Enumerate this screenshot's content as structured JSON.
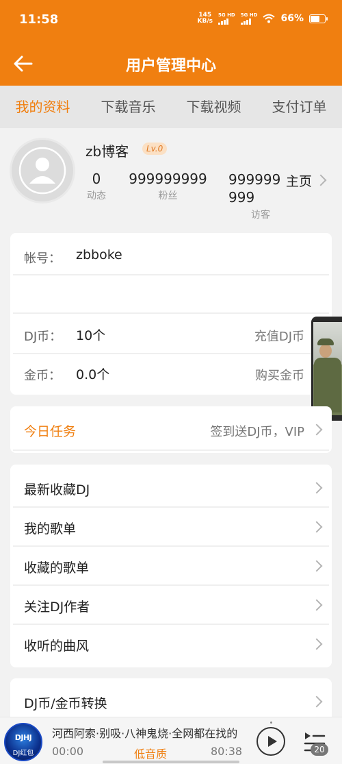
{
  "status_bar": {
    "time": "11:58",
    "net_speed_value": "145",
    "net_speed_unit": "KB/s",
    "sim1": "5G HD",
    "sim2": "5G HD",
    "battery": "66%"
  },
  "header": {
    "title": "用户管理中心",
    "back_icon": "back-arrow-icon"
  },
  "tabs": [
    {
      "label": "我的资料",
      "active": true
    },
    {
      "label": "下载音乐",
      "active": false
    },
    {
      "label": "下载视频",
      "active": false
    },
    {
      "label": "支付订单",
      "active": false
    }
  ],
  "profile": {
    "username": "zb博客",
    "level": "Lv.0",
    "stats": [
      {
        "value": "0",
        "label": "动态"
      },
      {
        "value": "999999999",
        "label": "粉丝"
      },
      {
        "value": "999999999",
        "label": "访客"
      }
    ],
    "homepage_label": "主页"
  },
  "account": {
    "account_label": "帐号：",
    "account_value": "zbboke",
    "dj_label": "DJ币：",
    "dj_value": "10个",
    "dj_action": "充值DJ币",
    "gold_label": "金币：",
    "gold_value": "0.0个",
    "gold_action": "购买金币"
  },
  "task": {
    "label": "今日任务",
    "action": "签到送DJ币，VIP"
  },
  "menu": [
    "最新收藏DJ",
    "我的歌单",
    "收藏的歌单",
    "关注DJ作者",
    "收听的曲风"
  ],
  "menu2": [
    "DJ币/金币转换"
  ],
  "player": {
    "logo_top": "DJHJ",
    "logo_bottom": "DJ红包",
    "song": "河西阿索·别吸·八神鬼烧·全网都在找的",
    "current_time": "00:00",
    "quality": "低音质",
    "duration": "80:38",
    "playlist_count": "20"
  },
  "colors": {
    "accent": "#f07f10",
    "background": "#f2f2f2"
  }
}
